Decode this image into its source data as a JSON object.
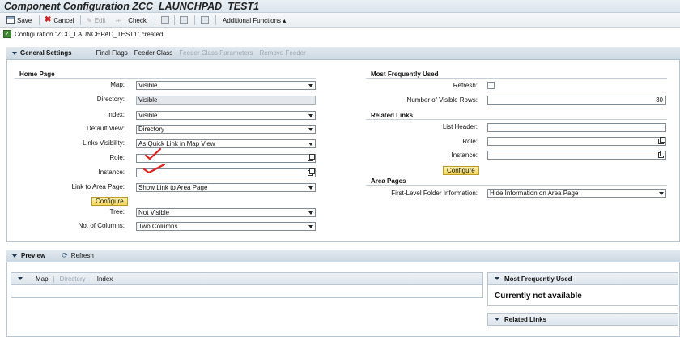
{
  "window": {
    "title": "Component Configuration ZCC_LAUNCHPAD_TEST1"
  },
  "toolbar": {
    "save": "Save",
    "cancel": "Cancel",
    "edit": "Edit",
    "check": "Check",
    "additional": "Additional Functions ▴"
  },
  "message": {
    "text": "Configuration \"ZCC_LAUNCHPAD_TEST1\" created"
  },
  "general": {
    "title": "General Settings",
    "tabs": [
      "Final Flags",
      "Feeder Class",
      "Feeder Class Parameters",
      "Remove Feeder"
    ],
    "home_page": {
      "title": "Home Page",
      "map_label": "Map:",
      "map_value": "Visible",
      "directory_label": "Directory:",
      "directory_value": "Visible",
      "index_label": "Index:",
      "index_value": "Visible",
      "default_view_label": "Default View:",
      "default_view_value": "Directory",
      "links_visibility_label": "Links Visibility:",
      "links_visibility_value": "As Quick Link in Map View",
      "role_label": "Role:",
      "role_value": "",
      "instance_label": "Instance:",
      "instance_value": "",
      "link_area_label": "Link to Area Page:",
      "link_area_value": "Show Link to Area Page",
      "configure": "Configure",
      "tree_label": "Tree:",
      "tree_value": "Not Visible",
      "columns_label": "No. of Columns:",
      "columns_value": "Two Columns"
    },
    "most_used": {
      "title": "Most Frequently Used",
      "refresh_label": "Refresh:",
      "rows_label": "Number of Visible Rows:",
      "rows_value": "30"
    },
    "related": {
      "title": "Related Links",
      "list_header_label": "List Header:",
      "list_header_value": "",
      "role_label": "Role:",
      "role_value": "",
      "instance_label": "Instance:",
      "instance_value": "",
      "configure": "Configure"
    },
    "area_pages": {
      "title": "Area Pages",
      "first_level_label": "First-Level Folder Information:",
      "first_level_value": "Hide Information on Area Page"
    }
  },
  "preview": {
    "title": "Preview",
    "refresh": "Refresh",
    "tabs": {
      "map": "Map",
      "directory": "Directory",
      "index": "Index"
    },
    "most_used_title": "Most Frequently Used",
    "not_available": "Currently not available",
    "related_title": "Related Links"
  }
}
